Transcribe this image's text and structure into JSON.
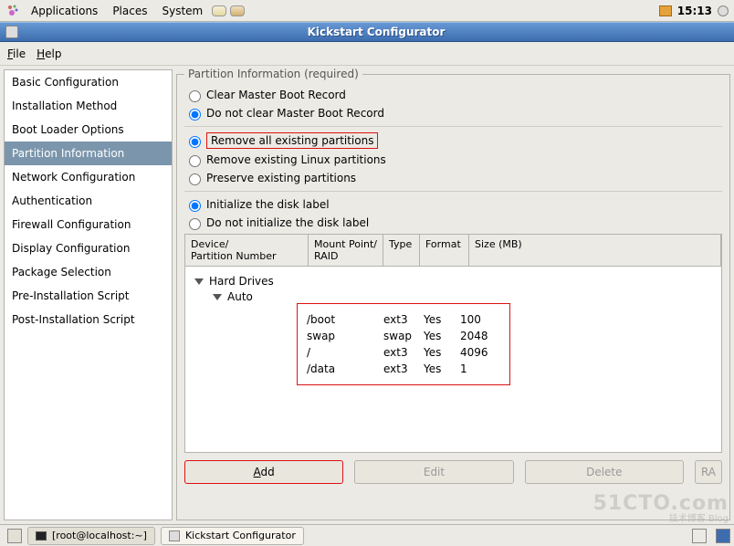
{
  "gnome": {
    "applications": "Applications",
    "places": "Places",
    "system": "System",
    "clock": "15:13"
  },
  "window": {
    "title": "Kickstart Configurator"
  },
  "menubar": {
    "file": "File",
    "help": "Help"
  },
  "sidebar": {
    "items": [
      {
        "label": "Basic Configuration"
      },
      {
        "label": "Installation Method"
      },
      {
        "label": "Boot Loader Options"
      },
      {
        "label": "Partition Information"
      },
      {
        "label": "Network Configuration"
      },
      {
        "label": "Authentication"
      },
      {
        "label": "Firewall Configuration"
      },
      {
        "label": "Display Configuration"
      },
      {
        "label": "Package Selection"
      },
      {
        "label": "Pre-Installation Script"
      },
      {
        "label": "Post-Installation Script"
      }
    ],
    "selected_index": 3
  },
  "content": {
    "legend": "Partition Information (required)",
    "mbr": {
      "clear": "Clear Master Boot Record",
      "noclear": "Do not clear Master Boot Record",
      "selected": "noclear"
    },
    "partitions": {
      "remove_all": "Remove all existing partitions",
      "remove_linux": "Remove existing Linux partitions",
      "preserve": "Preserve existing partitions",
      "selected": "remove_all"
    },
    "disklabel": {
      "init": "Initialize the disk label",
      "noinit": "Do not initialize the disk label",
      "selected": "init"
    },
    "table": {
      "headers": {
        "device": "Device/\nPartition Number",
        "mount": "Mount Point/\nRAID",
        "type": "Type",
        "format": "Format",
        "size": "Size (MB)"
      },
      "tree": {
        "root": "Hard Drives",
        "child": "Auto"
      },
      "rows": [
        {
          "mount": "/boot",
          "type": "ext3",
          "format": "Yes",
          "size": "100"
        },
        {
          "mount": "swap",
          "type": "swap",
          "format": "Yes",
          "size": "2048"
        },
        {
          "mount": "/",
          "type": "ext3",
          "format": "Yes",
          "size": "4096"
        },
        {
          "mount": "/data",
          "type": "ext3",
          "format": "Yes",
          "size": "1"
        }
      ]
    },
    "buttons": {
      "add": "Add",
      "edit": "Edit",
      "delete": "Delete",
      "raid": "RA"
    }
  },
  "taskbar": {
    "terminal": "[root@localhost:~]",
    "app": "Kickstart Configurator"
  },
  "watermark": {
    "brand": "51CTO.com",
    "sub": "技术博客  Blog"
  }
}
